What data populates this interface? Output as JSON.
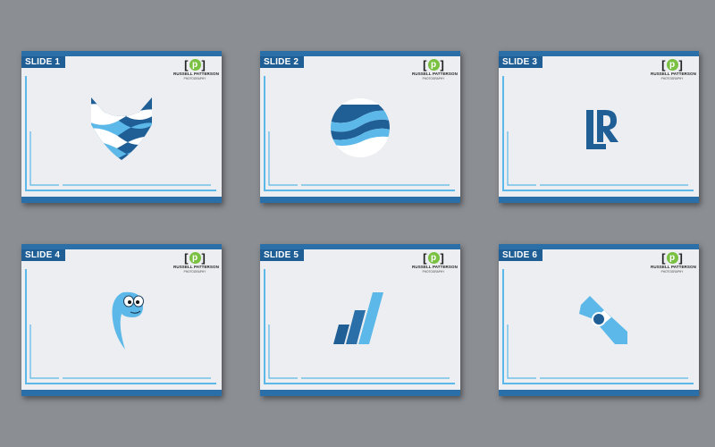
{
  "slides": [
    {
      "label": "SLIDE 1",
      "logo": {
        "mark": "p",
        "name": "RUSSELL PATTERSON",
        "sub": "PHOTOGRAPHY"
      },
      "icon": "chevron-wave-icon"
    },
    {
      "label": "SLIDE 2",
      "logo": {
        "mark": "p",
        "name": "RUSSELL PATTERSON",
        "sub": "PHOTOGRAPHY"
      },
      "icon": "wave-circle-icon"
    },
    {
      "label": "SLIDE 3",
      "logo": {
        "mark": "p",
        "name": "RUSSELL PATTERSON",
        "sub": "PHOTOGRAPHY"
      },
      "icon": "lr-monogram-icon"
    },
    {
      "label": "SLIDE 4",
      "logo": {
        "mark": "p",
        "name": "RUSSELL PATTERSON",
        "sub": "PHOTOGRAPHY"
      },
      "icon": "cartoon-character-icon"
    },
    {
      "label": "SLIDE 5",
      "logo": {
        "mark": "p",
        "name": "RUSSELL PATTERSON",
        "sub": "PHOTOGRAPHY"
      },
      "icon": "bar-stripes-icon"
    },
    {
      "label": "SLIDE 6",
      "logo": {
        "mark": "p",
        "name": "RUSSELL PATTERSON",
        "sub": "PHOTOGRAPHY"
      },
      "icon": "rotor-icon"
    }
  ],
  "colors": {
    "background": "#8b8e93",
    "slide": "#eceef1",
    "dark_blue": "#1f5f96",
    "light_blue": "#5bb8e8",
    "green": "#7ac142"
  }
}
